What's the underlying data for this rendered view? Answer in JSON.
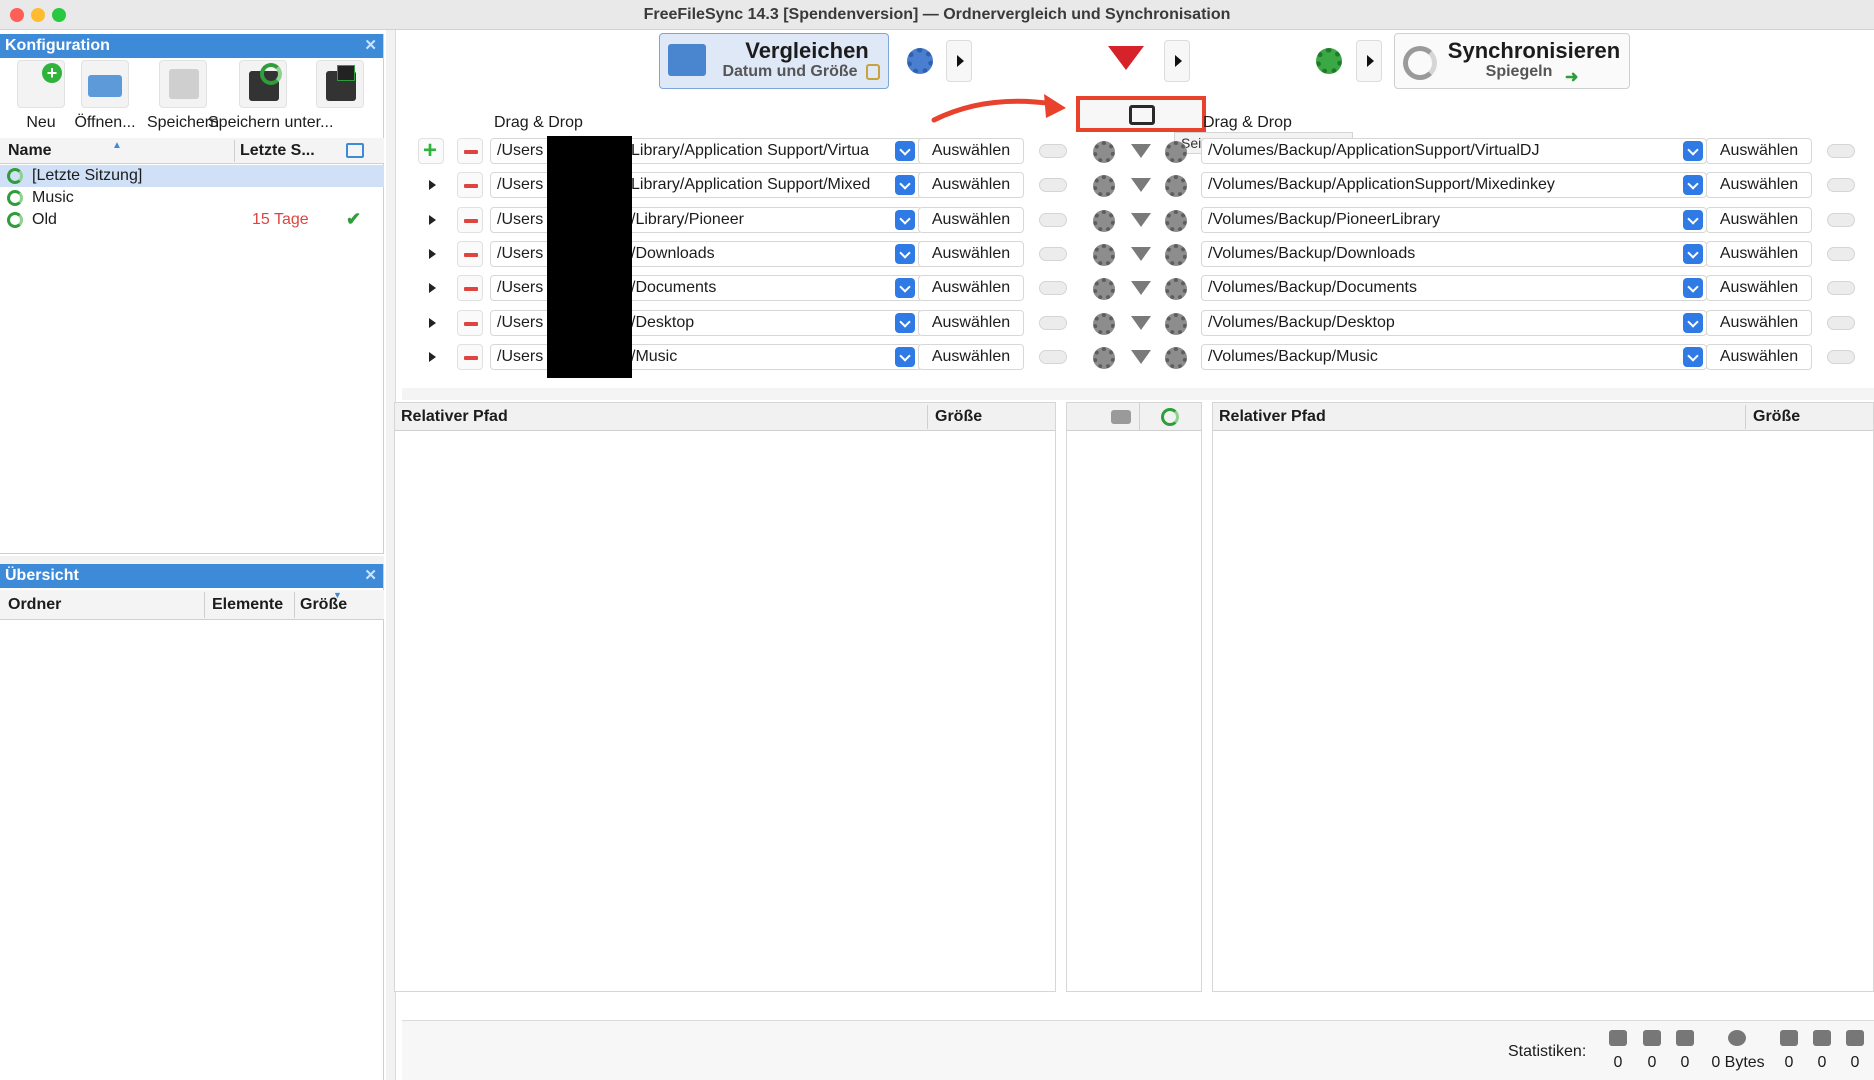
{
  "window": {
    "title": "FreeFileSync 14.3 [Spendenversion] — Ordnervergleich und Synchronisation"
  },
  "config_panel": {
    "title": "Konfiguration",
    "toolbar": {
      "new": "Neu",
      "open": "Öffnen...",
      "save": "Speichern",
      "save_as": "Speichern unter..."
    },
    "columns": {
      "name": "Name",
      "last_sync": "Letzte S..."
    },
    "items": [
      {
        "name": "[Letzte Sitzung]",
        "last_sync": ""
      },
      {
        "name": "Music",
        "last_sync": ""
      },
      {
        "name": "Old",
        "last_sync": "15 Tage"
      }
    ]
  },
  "overview_panel": {
    "title": "Übersicht",
    "columns": {
      "folder": "Ordner",
      "items": "Elemente",
      "size": "Größe"
    }
  },
  "compare": {
    "label": "Vergleichen",
    "variant": "Datum und Größe"
  },
  "synchronize": {
    "label": "Synchronisieren",
    "variant": "Spiegeln"
  },
  "folder_pairs": {
    "left_header": "Drag & Drop",
    "right_header": "Drag & Drop",
    "choose_label": "Auswählen",
    "swap_tooltip": "Seiten vertauschen (⌥ ⇥)",
    "rows": [
      {
        "left_prefix": "/Users",
        "left_suffix": "Library/Application Support/Virtua",
        "right": "/Volumes/Backup/ApplicationSupport/VirtualDJ"
      },
      {
        "left_prefix": "/Users",
        "left_suffix": "Library/Application Support/Mixed",
        "right": "/Volumes/Backup/ApplicationSupport/Mixedinkey"
      },
      {
        "left_prefix": "/Users",
        "left_suffix": "/Library/Pioneer",
        "right": "/Volumes/Backup/PioneerLibrary"
      },
      {
        "left_prefix": "/Users",
        "left_suffix": "/Downloads",
        "right": "/Volumes/Backup/Downloads"
      },
      {
        "left_prefix": "/Users",
        "left_suffix": "/Documents",
        "right": "/Volumes/Backup/Documents"
      },
      {
        "left_prefix": "/Users",
        "left_suffix": "/Desktop",
        "right": "/Volumes/Backup/Desktop"
      },
      {
        "left_prefix": "/Users",
        "left_suffix": "/Music",
        "right": "/Volumes/Backup/Music"
      }
    ]
  },
  "file_grid": {
    "left": {
      "path_col": "Relativer Pfad",
      "size_col": "Größe"
    },
    "right": {
      "path_col": "Relativer Pfad",
      "size_col": "Größe"
    }
  },
  "status_bar": {
    "label": "Statistiken:",
    "values": [
      "0",
      "0",
      "0",
      "0 Bytes",
      "0",
      "0",
      "0"
    ]
  },
  "colors": {
    "accent": "#3d8ad8",
    "highlight_box": "#e8412c",
    "warning_text": "#e0443e",
    "ok": "#2f9e3a"
  }
}
